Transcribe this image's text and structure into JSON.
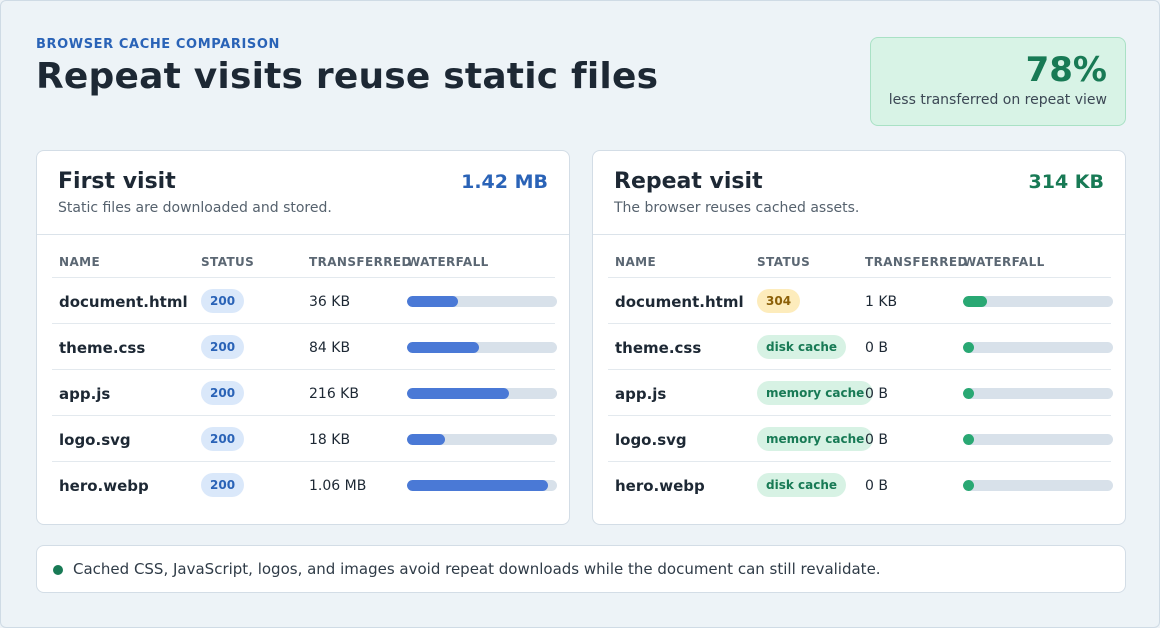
{
  "header": {
    "eyebrow": "BROWSER CACHE COMPARISON",
    "title": "Repeat visits reuse static files"
  },
  "stat": {
    "value": "78%",
    "caption": "less transferred on repeat view"
  },
  "columns": {
    "name": "NAME",
    "status": "STATUS",
    "transferred": "TRANSFERRED",
    "waterfall": "WATERFALL"
  },
  "first_visit": {
    "title": "First visit",
    "subtitle": "Static files are downloaded and stored.",
    "total": "1.42 MB",
    "rows": [
      {
        "name": "document.html",
        "status": "200",
        "size": "36 KB",
        "waterfall_fraction": 0.34
      },
      {
        "name": "theme.css",
        "status": "200",
        "size": "84 KB",
        "waterfall_fraction": 0.48
      },
      {
        "name": "app.js",
        "status": "200",
        "size": "216 KB",
        "waterfall_fraction": 0.68
      },
      {
        "name": "logo.svg",
        "status": "200",
        "size": "18 KB",
        "waterfall_fraction": 0.25
      },
      {
        "name": "hero.webp",
        "status": "200",
        "size": "1.06 MB",
        "waterfall_fraction": 0.94
      }
    ]
  },
  "repeat_visit": {
    "title": "Repeat visit",
    "subtitle": "The browser reuses cached assets.",
    "total": "314 KB",
    "rows": [
      {
        "name": "document.html",
        "status": "304",
        "size": "1 KB",
        "waterfall_fraction": 0.16
      },
      {
        "name": "theme.css",
        "status": "disk cache",
        "size": "0 B",
        "waterfall_fraction": 0.06
      },
      {
        "name": "app.js",
        "status": "memory cache",
        "size": "0 B",
        "waterfall_fraction": 0.05
      },
      {
        "name": "logo.svg",
        "status": "memory cache",
        "size": "0 B",
        "waterfall_fraction": 0.05
      },
      {
        "name": "hero.webp",
        "status": "disk cache",
        "size": "0 B",
        "waterfall_fraction": 0.06
      }
    ]
  },
  "note": {
    "text": "Cached CSS, JavaScript, logos, and images avoid repeat downloads while the document can still revalidate."
  },
  "colors": {
    "accent_blue": "#2a63b7",
    "accent_green": "#187a55",
    "bar_blue": "#4a79d6",
    "bar_green": "#29a873",
    "status_304": "#fdecbc"
  }
}
